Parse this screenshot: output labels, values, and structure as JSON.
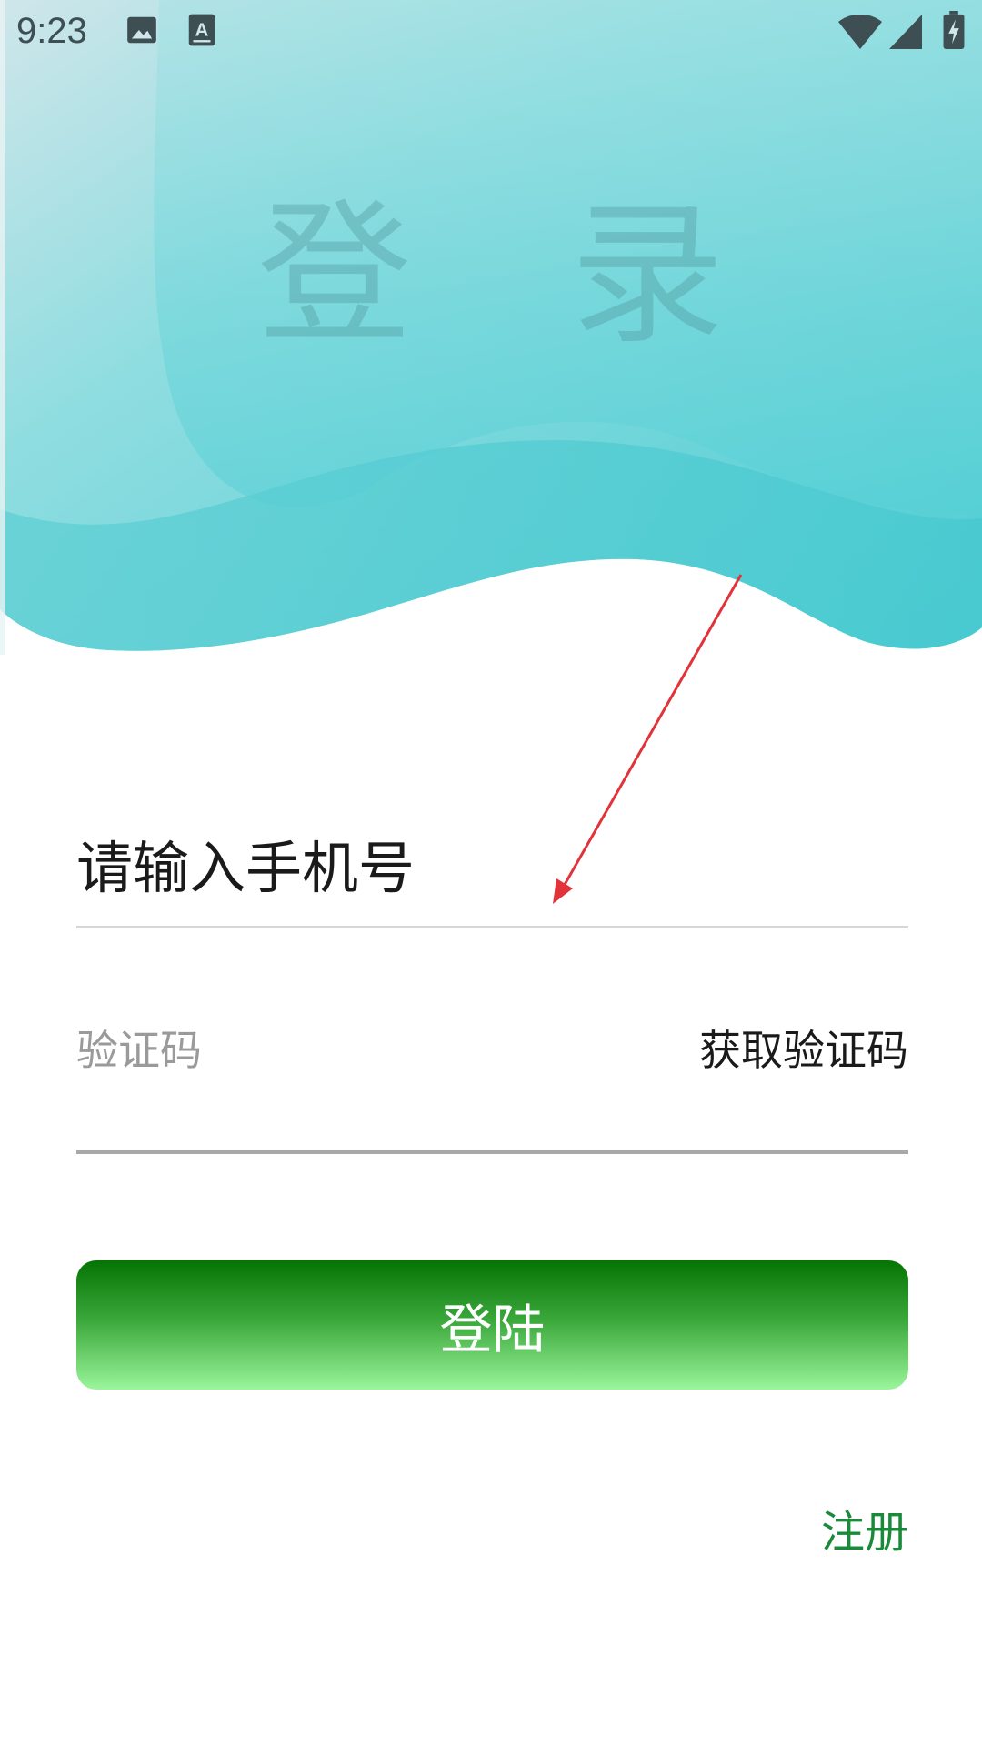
{
  "status_bar": {
    "time": "9:23",
    "icons": [
      "image-icon",
      "keyboard-a-icon",
      "wifi-icon",
      "signal-icon",
      "battery-charging-icon"
    ]
  },
  "header": {
    "title": "登 录"
  },
  "form": {
    "phone_placeholder": "请输入手机号",
    "code_placeholder": "验证码",
    "get_code_label": "获取验证码",
    "login_label": "登陆",
    "register_label": "注册"
  },
  "colors": {
    "wave_teal": "#4fcfd4",
    "login_gradient_top": "#047404",
    "login_gradient_bottom": "#9af59a",
    "register_green": "#1a8a3a",
    "annotation_arrow": "#e0333a"
  }
}
